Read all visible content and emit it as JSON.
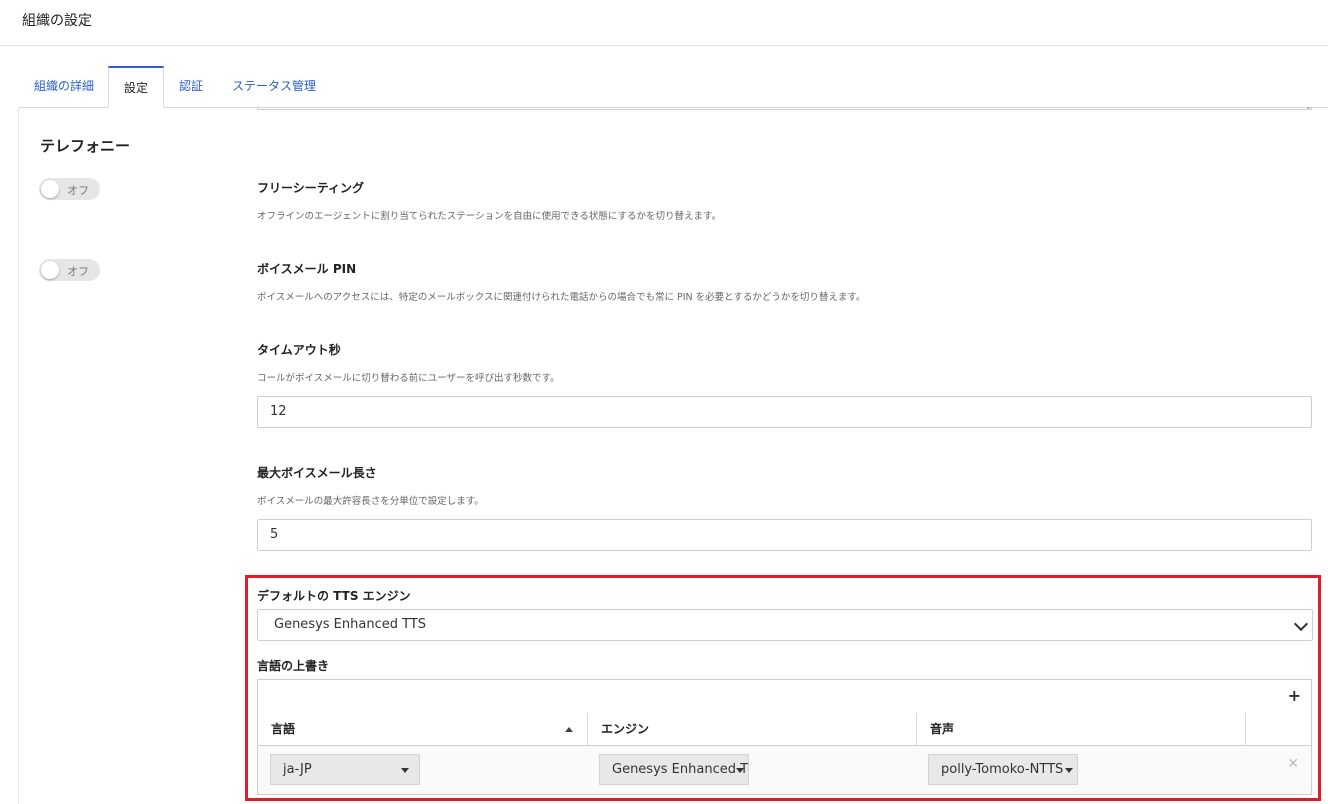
{
  "header": {
    "title": "組織の設定"
  },
  "tabs": [
    {
      "label": "組織の詳細"
    },
    {
      "label": "設定"
    },
    {
      "label": "認証"
    },
    {
      "label": "ステータス管理"
    }
  ],
  "active_tab": "設定",
  "section": {
    "title": "テレフォニー"
  },
  "free_seating": {
    "toggle": "オフ",
    "label": "フリーシーティング",
    "desc": "オフラインのエージェントに割り当てられたステーションを自由に使用できる状態にするかを切り替えます。"
  },
  "voicemail_pin": {
    "toggle": "オフ",
    "label": "ボイスメール PIN",
    "desc": "ボイスメールへのアクセスには、特定のメールボックスに関連付けられた電話からの場合でも常に PIN を必要とするかどうかを切り替えます。"
  },
  "timeout": {
    "label": "タイムアウト秒",
    "desc": "コールがボイスメールに切り替わる前にユーザーを呼び出す秒数です。",
    "value": "12"
  },
  "max_voicemail": {
    "label": "最大ボイスメール長さ",
    "desc": "ボイスメールの最大許容長さを分単位で設定します。",
    "value": "5"
  },
  "tts": {
    "label": "デフォルトの TTS エンジン",
    "value": "Genesys Enhanced TTS"
  },
  "language_override": {
    "label": "言語の上書き",
    "add_icon": "plus-icon",
    "columns": [
      "言語",
      "エンジン",
      "音声"
    ],
    "rows": [
      {
        "language": "ja-JP",
        "engine": "Genesys Enhanced TTS",
        "voice": "polly-Tomoko-NTTS"
      }
    ]
  },
  "colors": {
    "highlight": "#e11d29",
    "link": "#2a60c8"
  }
}
